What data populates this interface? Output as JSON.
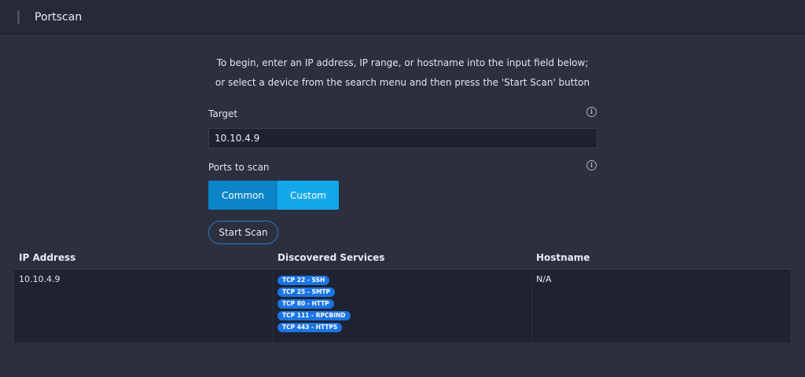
{
  "header": {
    "title": "Portscan"
  },
  "intro": {
    "line1": "To begin, enter an IP address, IP range, or hostname into the input field below;",
    "line2": "or select a device from the search menu and then press the 'Start Scan' button"
  },
  "target": {
    "label": "Target",
    "value": "10.10.4.9",
    "info_icon": "info-icon"
  },
  "ports": {
    "label": "Ports to scan",
    "info_icon": "info-icon",
    "options": [
      "Common",
      "Custom"
    ],
    "selected": "Custom"
  },
  "start_button": {
    "label": "Start Scan"
  },
  "table": {
    "columns": [
      "IP Address",
      "Discovered Services",
      "Hostname"
    ],
    "rows": [
      {
        "ip": "10.10.4.9",
        "services": [
          "TCP 22 - SSH",
          "TCP 25 - SMTP",
          "TCP 80 - HTTP",
          "TCP 111 - RPCBIND",
          "TCP 443 - HTTPS"
        ],
        "hostname": "N/A"
      }
    ]
  },
  "colors": {
    "background": "#2b2f3e",
    "header": "#252938",
    "accent_dark": "#0b84c8",
    "accent_light": "#13a7ea",
    "badge": "#1b74e4"
  }
}
